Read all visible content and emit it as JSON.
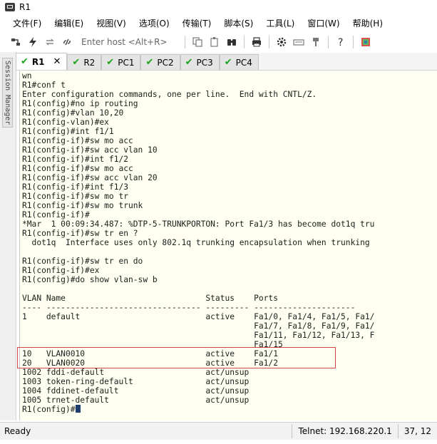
{
  "window": {
    "title": "R1"
  },
  "menu": {
    "items": [
      "文件(F)",
      "编辑(E)",
      "视图(V)",
      "选项(O)",
      "传输(T)",
      "脚本(S)",
      "工具(L)",
      "窗口(W)",
      "帮助(H)"
    ]
  },
  "toolbar": {
    "host_placeholder": "Enter host <Alt+R>"
  },
  "session_manager": {
    "label": "Session Manager"
  },
  "tabs": [
    {
      "label": "R1",
      "active": true,
      "has_close": true
    },
    {
      "label": "R2",
      "active": false
    },
    {
      "label": "PC1",
      "active": false
    },
    {
      "label": "PC2",
      "active": false
    },
    {
      "label": "PC3",
      "active": false
    },
    {
      "label": "PC4",
      "active": false
    }
  ],
  "terminal": {
    "lines": [
      "wn",
      "R1#conf t",
      "Enter configuration commands, one per line.  End with CNTL/Z.",
      "R1(config)#no ip routing",
      "R1(config)#vlan 10,20",
      "R1(config-vlan)#ex",
      "R1(config)#int f1/1",
      "R1(config-if)#sw mo acc",
      "R1(config-if)#sw acc vlan 10",
      "R1(config-if)#int f1/2",
      "R1(config-if)#sw mo acc",
      "R1(config-if)#sw acc vlan 20",
      "R1(config-if)#int f1/3",
      "R1(config-if)#sw mo tr",
      "R1(config-if)#sw mo trunk",
      "R1(config-if)#",
      "*Mar  1 00:09:34.487: %DTP-5-TRUNKPORTON: Port Fa1/3 has become dot1q tru",
      "R1(config-if)#sw tr en ?",
      "  dot1q  Interface uses only 802.1q trunking encapsulation when trunking",
      "",
      "R1(config-if)#sw tr en do",
      "R1(config-if)#ex",
      "R1(config)#do show vlan-sw b",
      "",
      "VLAN Name                             Status    Ports",
      "---- -------------------------------- --------- ---------------------",
      "1    default                          active    Fa1/0, Fa1/4, Fa1/5, Fa1/",
      "                                                Fa1/7, Fa1/8, Fa1/9, Fa1/",
      "                                                Fa1/11, Fa1/12, Fa1/13, F",
      "                                                Fa1/15",
      "10   VLAN0010                         active    Fa1/1",
      "20   VLAN0020                         active    Fa1/2",
      "1002 fddi-default                     act/unsup",
      "1003 token-ring-default               act/unsup",
      "1004 fddinet-default                  act/unsup",
      "1005 trnet-default                    act/unsup"
    ],
    "prompt": "R1(config)#"
  },
  "status": {
    "left": "Ready",
    "connection": "Telnet: 192.168.220.1",
    "position": "37, 12"
  }
}
